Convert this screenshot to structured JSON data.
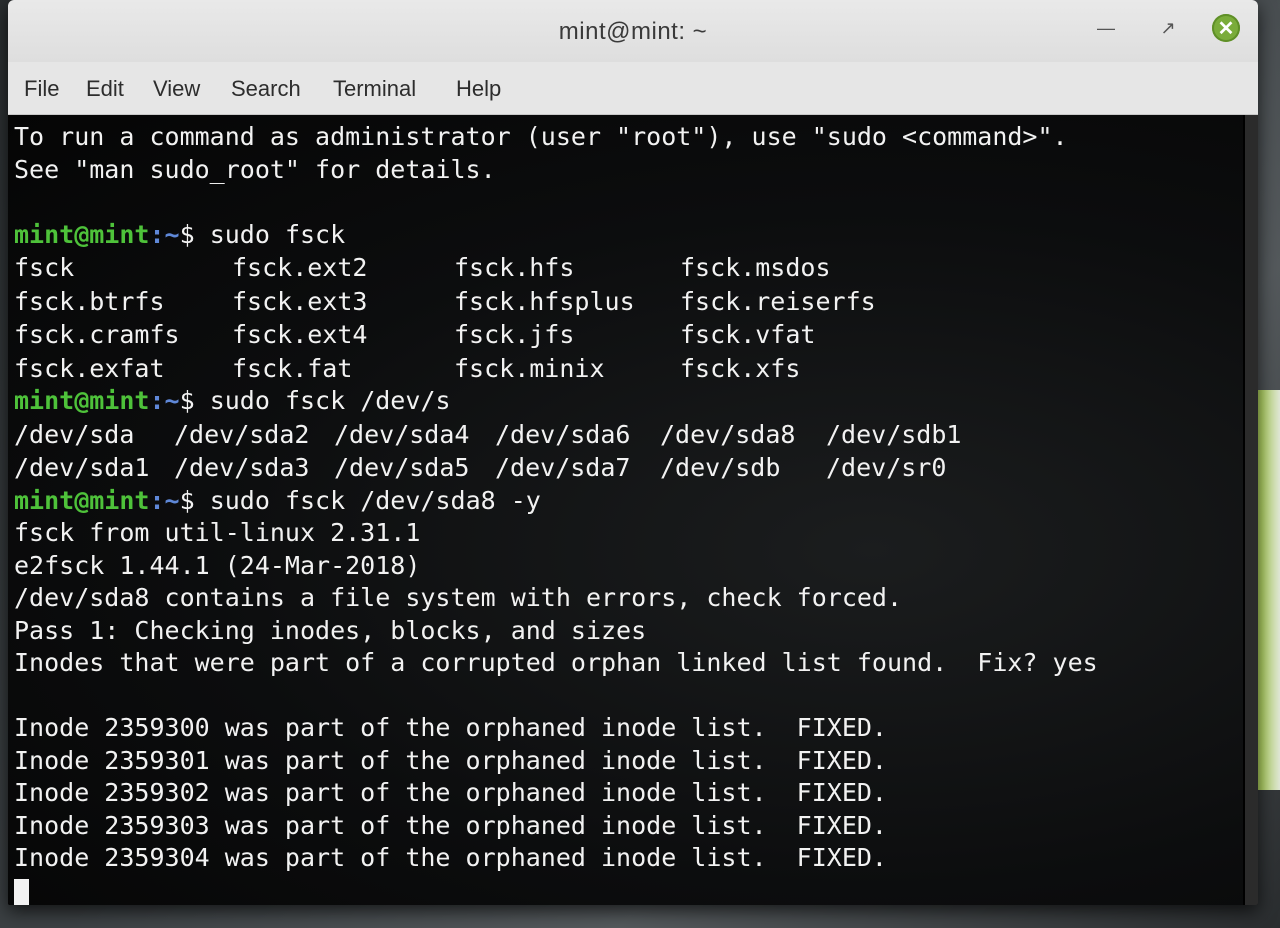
{
  "window": {
    "title": "mint@mint: ~"
  },
  "menu": {
    "file": "File",
    "edit": "Edit",
    "view": "View",
    "search": "Search",
    "terminal": "Terminal",
    "help": "Help"
  },
  "icons": {
    "minimize": "minimize-icon",
    "maximize": "maximize-icon",
    "close": "close-icon"
  },
  "colors": {
    "prompt_user": "#4ec23a",
    "prompt_path": "#5f88d8",
    "close_button": "#7aac3a",
    "terminal_bg": "#0c0d0e",
    "text": "#f2f2f2"
  },
  "terminal": {
    "intro": [
      "To run a command as administrator (user \"root\"), use \"sudo <command>\".",
      "See \"man sudo_root\" for details."
    ],
    "prompt_user": "mint@mint",
    "prompt_path": ":~",
    "prompt_symbol": "$",
    "cmd1": " sudo fsck",
    "fsck_completions": [
      [
        "fsck",
        "fsck.ext2",
        "fsck.hfs",
        "fsck.msdos"
      ],
      [
        "fsck.btrfs",
        "fsck.ext3",
        "fsck.hfsplus",
        "fsck.reiserfs"
      ],
      [
        "fsck.cramfs",
        "fsck.ext4",
        "fsck.jfs",
        "fsck.vfat"
      ],
      [
        "fsck.exfat",
        "fsck.fat",
        "fsck.minix",
        "fsck.xfs"
      ]
    ],
    "cmd2": " sudo fsck /dev/s",
    "dev_completions": [
      [
        "/dev/sda",
        "/dev/sda2",
        "/dev/sda4",
        "/dev/sda6",
        "/dev/sda8",
        "/dev/sdb1"
      ],
      [
        "/dev/sda1",
        "/dev/sda3",
        "/dev/sda5",
        "/dev/sda7",
        "/dev/sdb",
        "/dev/sr0"
      ]
    ],
    "cmd3": " sudo fsck /dev/sda8 -y",
    "output": [
      "fsck from util-linux 2.31.1",
      "e2fsck 1.44.1 (24-Mar-2018)",
      "/dev/sda8 contains a file system with errors, check forced.",
      "Pass 1: Checking inodes, blocks, and sizes",
      "Inodes that were part of a corrupted orphan linked list found.  Fix? yes"
    ],
    "inode_lines": [
      "Inode 2359300 was part of the orphaned inode list.  FIXED.",
      "Inode 2359301 was part of the orphaned inode list.  FIXED.",
      "Inode 2359302 was part of the orphaned inode list.  FIXED.",
      "Inode 2359303 was part of the orphaned inode list.  FIXED.",
      "Inode 2359304 was part of the orphaned inode list.  FIXED."
    ]
  }
}
